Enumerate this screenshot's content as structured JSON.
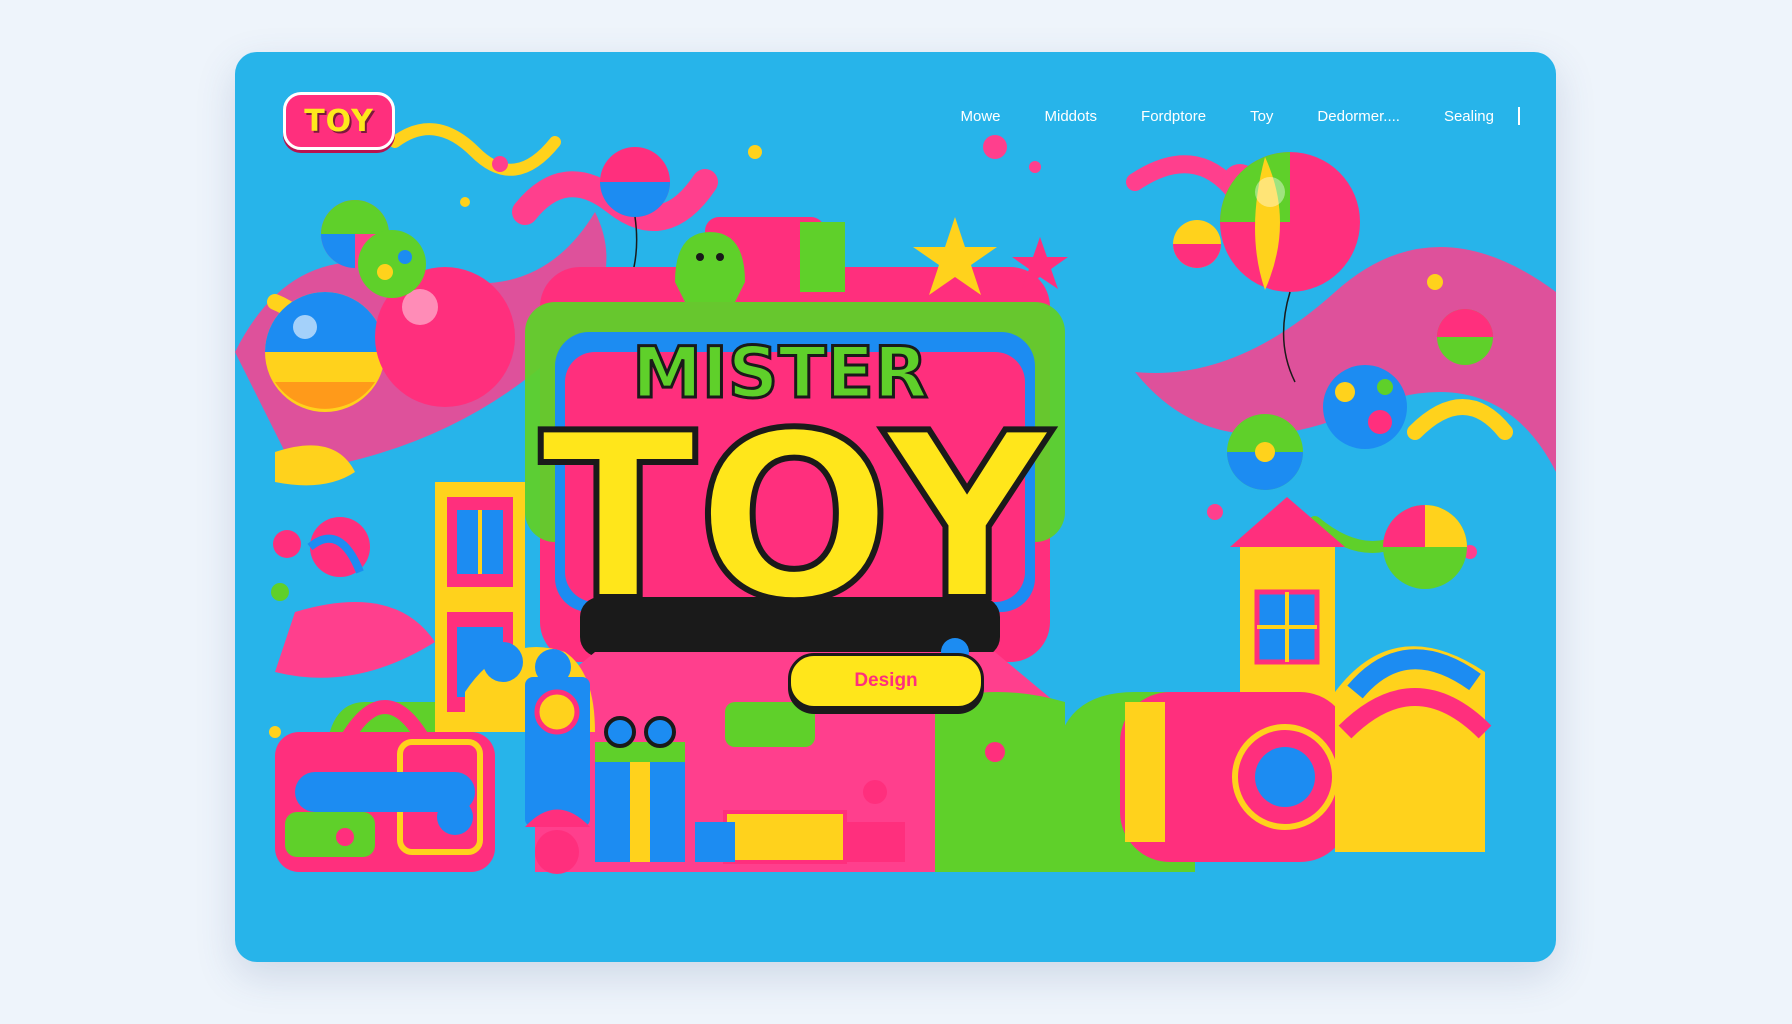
{
  "app": {
    "logo_text": "TOY"
  },
  "nav": {
    "items": [
      {
        "label": "Mowe"
      },
      {
        "label": "Middots"
      },
      {
        "label": "Fordptore"
      },
      {
        "label": "Toy"
      },
      {
        "label": "Dedormer...."
      },
      {
        "label": "Sealing"
      }
    ]
  },
  "hero": {
    "title_top": "MISTER",
    "title_main": "TOY",
    "cta_label": "Design"
  },
  "colors": {
    "window_bg": "#27b4ea",
    "pink": "#ff2f7d",
    "yellow": "#ffe61b",
    "green": "#5fd02a",
    "blue": "#1c8cf2",
    "orange": "#ff9a1a"
  },
  "icons": [
    "logo-badge",
    "ball-icon",
    "star-icon",
    "balloon-icon",
    "house-icon",
    "car-icon",
    "gift-icon"
  ]
}
